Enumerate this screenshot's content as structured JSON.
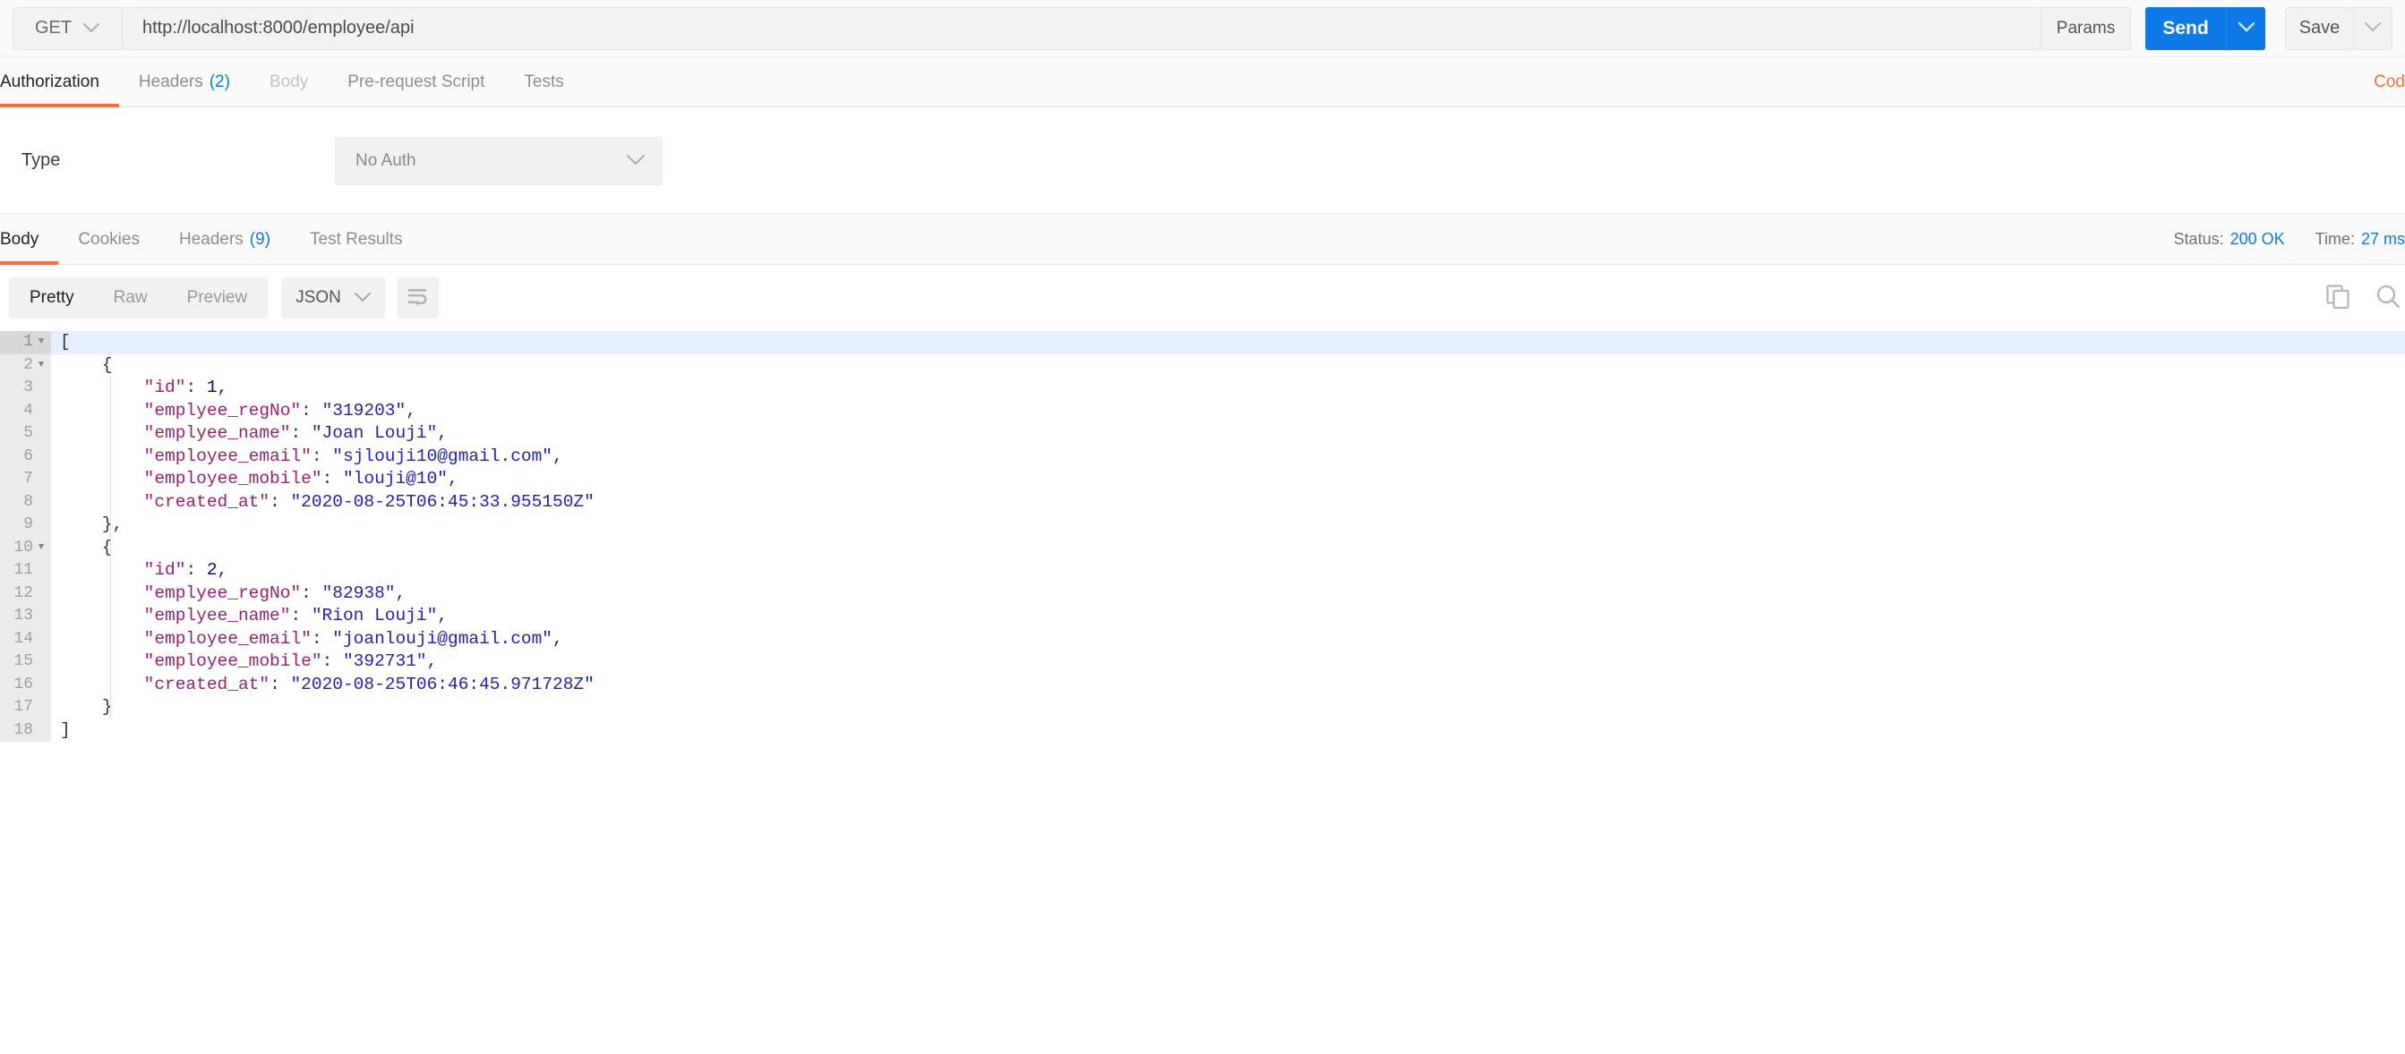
{
  "request": {
    "method": "GET",
    "url": "http://localhost:8000/employee/api",
    "params_label": "Params",
    "send_label": "Send",
    "save_label": "Save"
  },
  "request_tabs": [
    {
      "label": "Authorization",
      "count": "",
      "state": "active"
    },
    {
      "label": "Headers",
      "count": "(2)",
      "state": "normal"
    },
    {
      "label": "Body",
      "count": "",
      "state": "disabled"
    },
    {
      "label": "Pre-request Script",
      "count": "",
      "state": "normal"
    },
    {
      "label": "Tests",
      "count": "",
      "state": "normal"
    }
  ],
  "code_link": "Cod",
  "auth": {
    "type_label": "Type",
    "type_value": "No Auth"
  },
  "response_tabs": [
    {
      "label": "Body",
      "count": "",
      "state": "active"
    },
    {
      "label": "Cookies",
      "count": "",
      "state": "normal"
    },
    {
      "label": "Headers",
      "count": "(9)",
      "state": "normal"
    },
    {
      "label": "Test Results",
      "count": "",
      "state": "normal"
    }
  ],
  "response_meta": {
    "status_label": "Status:",
    "status_value": "200 OK",
    "time_label": "Time:",
    "time_value": "27 ms"
  },
  "body_toolbar": {
    "views": [
      {
        "label": "Pretty",
        "state": "active"
      },
      {
        "label": "Raw",
        "state": "normal"
      },
      {
        "label": "Preview",
        "state": "normal"
      }
    ],
    "format": "JSON"
  },
  "colors": {
    "accent_orange": "#ff6c37",
    "accent_blue": "#0d7ae8",
    "json_key": "#9c1e6e",
    "json_string": "#2020c8",
    "json_number": "#0000c8",
    "active_line": "#e6efff"
  },
  "response_body": {
    "lines": [
      {
        "no": "1",
        "fold": true,
        "indent": 0,
        "tokens": [
          {
            "t": "p",
            "v": "["
          }
        ]
      },
      {
        "no": "2",
        "fold": true,
        "indent": 1,
        "tokens": [
          {
            "t": "p",
            "v": "{"
          }
        ]
      },
      {
        "no": "3",
        "fold": false,
        "indent": 2,
        "tokens": [
          {
            "t": "k",
            "v": "\"id\""
          },
          {
            "t": "p",
            "v": ": "
          },
          {
            "t": "n",
            "v": "1"
          },
          {
            "t": "p",
            "v": ","
          }
        ]
      },
      {
        "no": "4",
        "fold": false,
        "indent": 2,
        "tokens": [
          {
            "t": "k",
            "v": "\"emplyee_regNo\""
          },
          {
            "t": "p",
            "v": ": "
          },
          {
            "t": "s",
            "v": "\"319203\""
          },
          {
            "t": "p",
            "v": ","
          }
        ]
      },
      {
        "no": "5",
        "fold": false,
        "indent": 2,
        "tokens": [
          {
            "t": "k",
            "v": "\"emplyee_name\""
          },
          {
            "t": "p",
            "v": ": "
          },
          {
            "t": "s",
            "v": "\"Joan Louji\""
          },
          {
            "t": "p",
            "v": ","
          }
        ]
      },
      {
        "no": "6",
        "fold": false,
        "indent": 2,
        "tokens": [
          {
            "t": "k",
            "v": "\"employee_email\""
          },
          {
            "t": "p",
            "v": ": "
          },
          {
            "t": "s",
            "v": "\"sjlouji10@gmail.com\""
          },
          {
            "t": "p",
            "v": ","
          }
        ]
      },
      {
        "no": "7",
        "fold": false,
        "indent": 2,
        "tokens": [
          {
            "t": "k",
            "v": "\"employee_mobile\""
          },
          {
            "t": "p",
            "v": ": "
          },
          {
            "t": "s",
            "v": "\"louji@10\""
          },
          {
            "t": "p",
            "v": ","
          }
        ]
      },
      {
        "no": "8",
        "fold": false,
        "indent": 2,
        "tokens": [
          {
            "t": "k",
            "v": "\"created_at\""
          },
          {
            "t": "p",
            "v": ": "
          },
          {
            "t": "s",
            "v": "\"2020-08-25T06:45:33.955150Z\""
          }
        ]
      },
      {
        "no": "9",
        "fold": false,
        "indent": 1,
        "tokens": [
          {
            "t": "p",
            "v": "},"
          }
        ]
      },
      {
        "no": "10",
        "fold": true,
        "indent": 1,
        "tokens": [
          {
            "t": "p",
            "v": "{"
          }
        ]
      },
      {
        "no": "11",
        "fold": false,
        "indent": 2,
        "tokens": [
          {
            "t": "k",
            "v": "\"id\""
          },
          {
            "t": "p",
            "v": ": "
          },
          {
            "t": "n",
            "v": "2"
          },
          {
            "t": "p",
            "v": ","
          }
        ]
      },
      {
        "no": "12",
        "fold": false,
        "indent": 2,
        "tokens": [
          {
            "t": "k",
            "v": "\"emplyee_regNo\""
          },
          {
            "t": "p",
            "v": ": "
          },
          {
            "t": "s",
            "v": "\"82938\""
          },
          {
            "t": "p",
            "v": ","
          }
        ]
      },
      {
        "no": "13",
        "fold": false,
        "indent": 2,
        "tokens": [
          {
            "t": "k",
            "v": "\"emplyee_name\""
          },
          {
            "t": "p",
            "v": ": "
          },
          {
            "t": "s",
            "v": "\"Rion Louji\""
          },
          {
            "t": "p",
            "v": ","
          }
        ]
      },
      {
        "no": "14",
        "fold": false,
        "indent": 2,
        "tokens": [
          {
            "t": "k",
            "v": "\"employee_email\""
          },
          {
            "t": "p",
            "v": ": "
          },
          {
            "t": "s",
            "v": "\"joanlouji@gmail.com\""
          },
          {
            "t": "p",
            "v": ","
          }
        ]
      },
      {
        "no": "15",
        "fold": false,
        "indent": 2,
        "tokens": [
          {
            "t": "k",
            "v": "\"employee_mobile\""
          },
          {
            "t": "p",
            "v": ": "
          },
          {
            "t": "s",
            "v": "\"392731\""
          },
          {
            "t": "p",
            "v": ","
          }
        ]
      },
      {
        "no": "16",
        "fold": false,
        "indent": 2,
        "tokens": [
          {
            "t": "k",
            "v": "\"created_at\""
          },
          {
            "t": "p",
            "v": ": "
          },
          {
            "t": "s",
            "v": "\"2020-08-25T06:46:45.971728Z\""
          }
        ]
      },
      {
        "no": "17",
        "fold": false,
        "indent": 1,
        "tokens": [
          {
            "t": "p",
            "v": "}"
          }
        ]
      },
      {
        "no": "18",
        "fold": false,
        "indent": 0,
        "tokens": [
          {
            "t": "p",
            "v": "]"
          }
        ]
      }
    ],
    "parsed": [
      {
        "id": 1,
        "emplyee_regNo": "319203",
        "emplyee_name": "Joan Louji",
        "employee_email": "sjlouji10@gmail.com",
        "employee_mobile": "louji@10",
        "created_at": "2020-08-25T06:45:33.955150Z"
      },
      {
        "id": 2,
        "emplyee_regNo": "82938",
        "emplyee_name": "Rion Louji",
        "employee_email": "joanlouji@gmail.com",
        "employee_mobile": "392731",
        "created_at": "2020-08-25T06:46:45.971728Z"
      }
    ]
  }
}
